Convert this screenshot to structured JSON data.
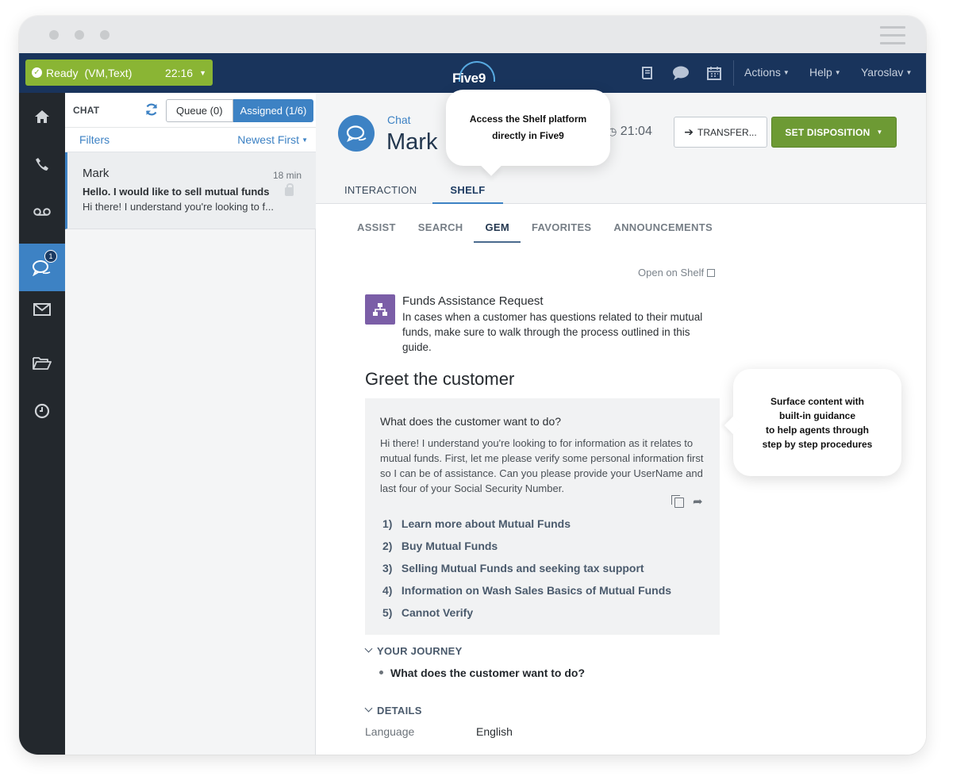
{
  "window": {
    "controls": [
      "close",
      "minimize",
      "maximize"
    ]
  },
  "status": {
    "state": "Ready",
    "channels": "(VM,Text)",
    "timer": "22:16",
    "color": "#8ab534"
  },
  "brand": {
    "name": "Five9"
  },
  "topbar": {
    "icons": [
      "book-icon",
      "chat-bubble-icon",
      "calendar-icon"
    ],
    "menus": {
      "actions": "Actions",
      "help": "Help",
      "user": "Yaroslav"
    }
  },
  "nav": {
    "items": [
      "home-icon",
      "phone-icon",
      "voicemail-icon",
      "chat-icon",
      "mail-icon",
      "folder-icon",
      "history-icon"
    ],
    "chat_badge": "1",
    "active": "chat"
  },
  "chat_list": {
    "title": "CHAT",
    "queue_label": "Queue (0)",
    "assigned_label": "Assigned (1/6)",
    "filters_label": "Filters",
    "sort_label": "Newest First",
    "items": [
      {
        "name": "Mark",
        "time": "18 min",
        "subject": "Hello. I would like to sell mutual funds",
        "preview": "Hi there! I understand you're looking to f..."
      }
    ]
  },
  "interaction": {
    "channel": "Chat",
    "customer": "Mark",
    "clock": "21:04",
    "transfer_label": "TRANSFER...",
    "disposition_label": "SET DISPOSITION",
    "tabs": [
      "INTERACTION",
      "SHELF"
    ],
    "active_tab": "SHELF"
  },
  "shelf": {
    "tabs": [
      "ASSIST",
      "SEARCH",
      "GEM",
      "FAVORITES",
      "ANNOUNCEMENTS"
    ],
    "active_tab": "GEM",
    "open_link": "Open on Shelf",
    "gem": {
      "title": "Funds Assistance Request",
      "description": "In cases when a customer has questions related to their mutual funds, make sure to walk through the process outlined in this guide.",
      "heading": "Greet the customer",
      "question": "What does the customer want to do?",
      "answer": "Hi there! I understand you're looking to for information as it relates to mutual funds. First, let me please verify some personal information first so I can be of assistance. Can you please provide your UserName and last four of your Social Security Number.",
      "options": [
        {
          "num": "1)",
          "label": "Learn more about Mutual Funds"
        },
        {
          "num": "2)",
          "label": "Buy Mutual Funds"
        },
        {
          "num": "3)",
          "label": "Selling Mutual Funds and seeking tax support"
        },
        {
          "num": "4)",
          "label": "Information on Wash Sales Basics of Mutual Funds"
        },
        {
          "num": "5)",
          "label": "Cannot Verify"
        }
      ]
    },
    "journey": {
      "title": "YOUR JOURNEY",
      "items": [
        "What does the customer want to do?"
      ]
    },
    "details": {
      "title": "DETAILS",
      "language_label": "Language",
      "language_value": "English"
    }
  },
  "callouts": {
    "top": "Access the Shelf platform\ndirectly in Five9",
    "side": "Surface content with\nbuilt-in guidance\nto help agents through\nstep by step procedures"
  }
}
